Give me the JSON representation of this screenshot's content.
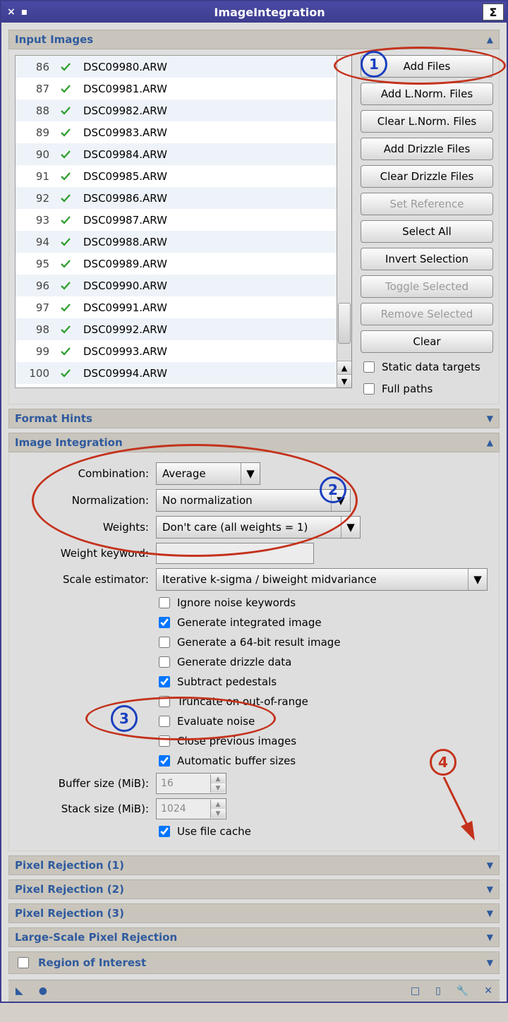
{
  "title": "ImageIntegration",
  "sections": {
    "input_images": "Input Images",
    "format_hints": "Format Hints",
    "image_integration": "Image Integration",
    "pixel_rej1": "Pixel Rejection (1)",
    "pixel_rej2": "Pixel Rejection (2)",
    "pixel_rej3": "Pixel Rejection (3)",
    "large_scale": "Large-Scale Pixel Rejection",
    "roi": "Region of Interest"
  },
  "files": [
    {
      "n": "86",
      "name": "DSC09980.ARW"
    },
    {
      "n": "87",
      "name": "DSC09981.ARW"
    },
    {
      "n": "88",
      "name": "DSC09982.ARW"
    },
    {
      "n": "89",
      "name": "DSC09983.ARW"
    },
    {
      "n": "90",
      "name": "DSC09984.ARW"
    },
    {
      "n": "91",
      "name": "DSC09985.ARW"
    },
    {
      "n": "92",
      "name": "DSC09986.ARW"
    },
    {
      "n": "93",
      "name": "DSC09987.ARW"
    },
    {
      "n": "94",
      "name": "DSC09988.ARW"
    },
    {
      "n": "95",
      "name": "DSC09989.ARW"
    },
    {
      "n": "96",
      "name": "DSC09990.ARW"
    },
    {
      "n": "97",
      "name": "DSC09991.ARW"
    },
    {
      "n": "98",
      "name": "DSC09992.ARW"
    },
    {
      "n": "99",
      "name": "DSC09993.ARW"
    },
    {
      "n": "100",
      "name": "DSC09994.ARW"
    }
  ],
  "side_buttons": {
    "add_files": "Add Files",
    "add_lnorm": "Add L.Norm. Files",
    "clear_lnorm": "Clear L.Norm. Files",
    "add_drizzle": "Add Drizzle Files",
    "clear_drizzle": "Clear Drizzle Files",
    "set_ref": "Set Reference",
    "select_all": "Select All",
    "invert": "Invert Selection",
    "toggle": "Toggle Selected",
    "remove": "Remove Selected",
    "clear": "Clear",
    "static_targets": "Static data targets",
    "full_paths": "Full paths"
  },
  "form": {
    "combination_lbl": "Combination:",
    "combination_val": "Average",
    "normalization_lbl": "Normalization:",
    "normalization_val": "No normalization",
    "weights_lbl": "Weights:",
    "weights_val": "Don't care (all weights = 1)",
    "weight_kw_lbl": "Weight keyword:",
    "weight_kw_val": "",
    "scale_est_lbl": "Scale estimator:",
    "scale_est_val": "Iterative k-sigma / biweight midvariance",
    "buffer_lbl": "Buffer size (MiB):",
    "buffer_val": "16",
    "stack_lbl": "Stack size (MiB):",
    "stack_val": "1024"
  },
  "checks": {
    "ignore_noise": "Ignore noise keywords",
    "gen_int": "Generate integrated image",
    "gen64": "Generate a 64-bit result image",
    "gen_driz": "Generate drizzle data",
    "sub_ped": "Subtract pedestals",
    "trunc": "Truncate on out-of-range",
    "eval_noise": "Evaluate noise",
    "close_prev": "Close previous images",
    "auto_buf": "Automatic buffer sizes",
    "use_cache": "Use file cache"
  },
  "annotations": {
    "n1": "1",
    "n2": "2",
    "n3": "3",
    "n4": "4"
  }
}
